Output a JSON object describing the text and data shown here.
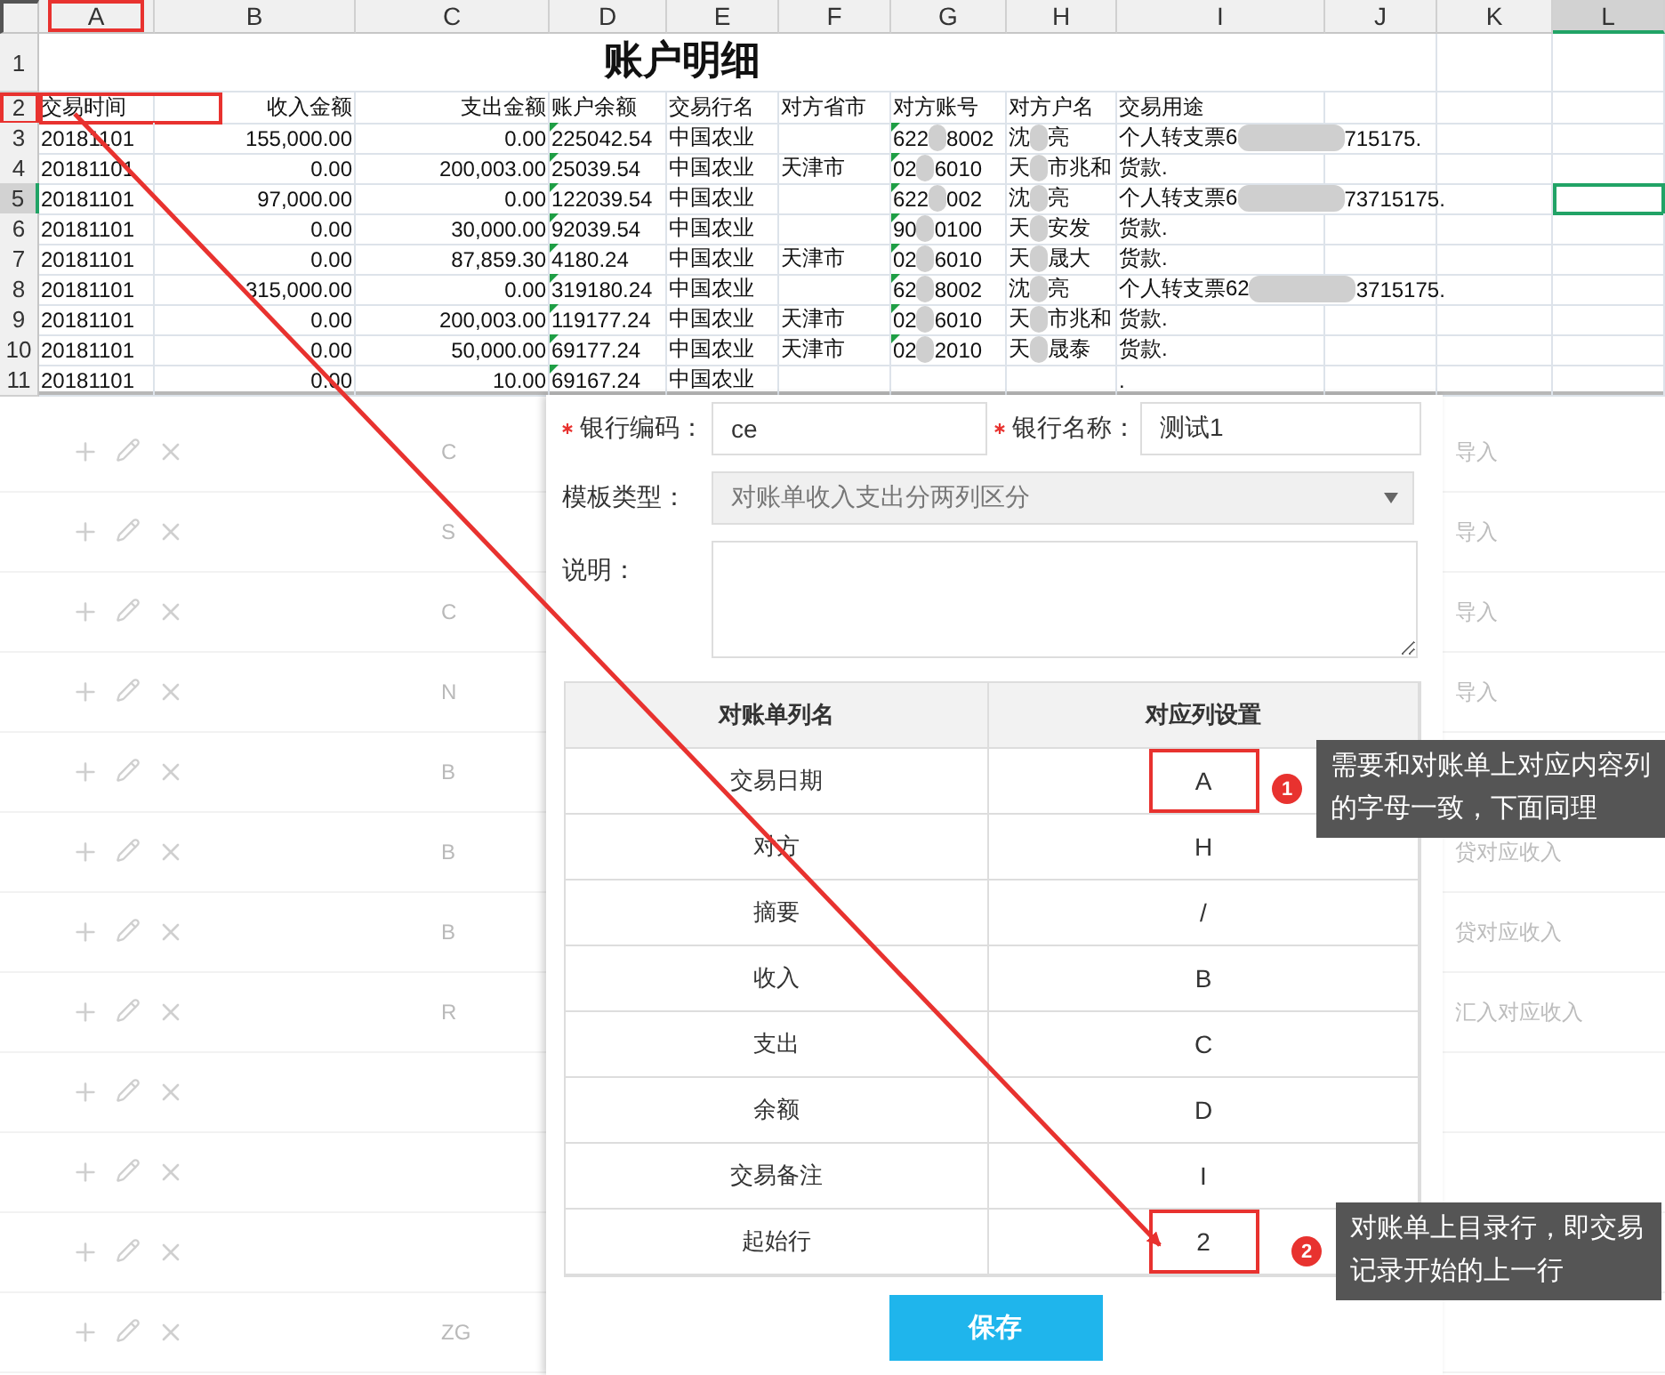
{
  "spreadsheet": {
    "columns": [
      {
        "label": "A",
        "selected": false,
        "annotated": true
      },
      {
        "label": "B",
        "selected": false,
        "annotated": false
      },
      {
        "label": "C",
        "selected": false,
        "annotated": false
      },
      {
        "label": "D",
        "selected": false,
        "annotated": false
      },
      {
        "label": "E",
        "selected": false,
        "annotated": false
      },
      {
        "label": "F",
        "selected": false,
        "annotated": false
      },
      {
        "label": "G",
        "selected": false,
        "annotated": false
      },
      {
        "label": "H",
        "selected": false,
        "annotated": false
      },
      {
        "label": "I",
        "selected": false,
        "annotated": false
      },
      {
        "label": "J",
        "selected": false,
        "annotated": false
      },
      {
        "label": "K",
        "selected": false,
        "annotated": false
      },
      {
        "label": "L",
        "selected": true,
        "annotated": false
      }
    ],
    "title_row": {
      "number": "1",
      "title": "账户明细"
    },
    "rows": [
      {
        "number": "2",
        "selected": false,
        "annotated": true,
        "cells": [
          "交易时间",
          "收入金额",
          "支出金额",
          "账户余额",
          "交易行名",
          "对方省市",
          "对方账号",
          "对方户名",
          "交易用途"
        ]
      },
      {
        "number": "3",
        "selected": false,
        "annotated": false,
        "cells": [
          "20181101",
          "155,000.00",
          "0.00",
          {
            "text": "225042.54",
            "flagged": true
          },
          "中国农业",
          "",
          {
            "before": "622",
            "after": "8002",
            "flagged": true
          },
          {
            "before": "沈",
            "after": "亮"
          },
          {
            "before": "个人转支票6",
            "after": "715175."
          }
        ]
      },
      {
        "number": "4",
        "selected": false,
        "annotated": false,
        "cells": [
          "20181101",
          "0.00",
          "200,003.00",
          {
            "text": "25039.54",
            "flagged": true
          },
          "中国农业",
          "天津市",
          {
            "before": "02",
            "after": "6010",
            "flagged": true
          },
          {
            "before": "天",
            "after": "市兆和"
          },
          "货款."
        ]
      },
      {
        "number": "5",
        "selected": true,
        "annotated": false,
        "cells": [
          "20181101",
          "97,000.00",
          "0.00",
          {
            "text": "122039.54",
            "flagged": true
          },
          "中国农业",
          "",
          {
            "before": "622",
            "after": "002",
            "flagged": true
          },
          {
            "before": "沈",
            "after": "亮"
          },
          {
            "before": "个人转支票6",
            "after": "73715175."
          }
        ]
      },
      {
        "number": "6",
        "selected": false,
        "annotated": false,
        "cells": [
          "20181101",
          "0.00",
          "30,000.00",
          {
            "text": "92039.54",
            "flagged": true
          },
          "中国农业",
          "",
          {
            "before": "90",
            "after": "0100",
            "flagged": true
          },
          {
            "before": "天",
            "after": "安发"
          },
          "货款."
        ]
      },
      {
        "number": "7",
        "selected": false,
        "annotated": false,
        "cells": [
          "20181101",
          "0.00",
          "87,859.30",
          {
            "text": "4180.24",
            "flagged": true
          },
          "中国农业",
          "天津市",
          {
            "before": "02",
            "after": "6010",
            "flagged": true
          },
          {
            "before": "天",
            "after": "晟大"
          },
          "货款."
        ]
      },
      {
        "number": "8",
        "selected": false,
        "annotated": false,
        "cells": [
          "20181101",
          "315,000.00",
          "0.00",
          {
            "text": "319180.24",
            "flagged": true
          },
          "中国农业",
          "",
          {
            "before": "62",
            "after": "8002",
            "flagged": true
          },
          {
            "before": "沈",
            "after": "亮"
          },
          {
            "before": "个人转支票62",
            "after": "3715175."
          }
        ]
      },
      {
        "number": "9",
        "selected": false,
        "annotated": false,
        "cells": [
          "20181101",
          "0.00",
          "200,003.00",
          {
            "text": "119177.24",
            "flagged": true
          },
          "中国农业",
          "天津市",
          {
            "before": "02",
            "after": "6010",
            "flagged": true
          },
          {
            "before": "天",
            "after": "市兆和"
          },
          "货款."
        ]
      },
      {
        "number": "10",
        "selected": false,
        "annotated": false,
        "cells": [
          "20181101",
          "0.00",
          "50,000.00",
          {
            "text": "69177.24",
            "flagged": true
          },
          "中国农业",
          "天津市",
          {
            "before": "02",
            "after": "2010",
            "flagged": true
          },
          {
            "before": "天",
            "after": "晟泰"
          },
          "货款."
        ]
      },
      {
        "number": "11",
        "selected": false,
        "annotated": false,
        "cells": [
          "20181101",
          "0.00",
          "10.00",
          {
            "text": "69167.24",
            "flagged": true
          },
          "中国农业",
          "",
          "",
          "",
          "."
        ]
      }
    ]
  },
  "background_list": {
    "rows": [
      {
        "code": "C",
        "note": "导入"
      },
      {
        "code": "S",
        "note": "导入"
      },
      {
        "code": "C",
        "note": "导入"
      },
      {
        "code": "N",
        "note": "导入"
      },
      {
        "code": "B"
      },
      {
        "code": "B",
        "note": "贷对应收入"
      },
      {
        "code": "B",
        "note": "贷对应收入"
      },
      {
        "code": "R",
        "note": "汇入对应收入"
      },
      {},
      {},
      {},
      {
        "code": "ZG"
      }
    ]
  },
  "dialog": {
    "fields": [
      {
        "label": "银行编码：",
        "required": true,
        "value": "ce"
      },
      {
        "label": "银行名称：",
        "required": true,
        "value": "测试1"
      }
    ],
    "template": {
      "label": "模板类型：",
      "value": "对账单收入支出分两列区分",
      "disabled": true
    },
    "description": {
      "label": "说明："
    },
    "mapping": {
      "columns": [
        "对账单列名",
        "对应列设置"
      ],
      "rows": [
        {
          "name": "交易日期",
          "value": "A",
          "annotated": true
        },
        {
          "name": "对方",
          "value": "H",
          "annotated": false
        },
        {
          "name": "摘要",
          "value": "/",
          "annotated": false
        },
        {
          "name": "收入",
          "value": "B",
          "annotated": false
        },
        {
          "name": "支出",
          "value": "C",
          "annotated": false
        },
        {
          "name": "余额",
          "value": "D",
          "annotated": false
        },
        {
          "name": "交易备注",
          "value": "I",
          "annotated": false
        },
        {
          "name": "起始行",
          "value": "2",
          "annotated": true
        }
      ]
    },
    "save_button": "保存"
  },
  "callouts": [
    {
      "number": "1",
      "text": "需要和对账单上对应内容列的字母一致，下面同理"
    },
    {
      "number": "2",
      "text": "对账单上目录行，即交易记录开始的上一行"
    }
  ]
}
